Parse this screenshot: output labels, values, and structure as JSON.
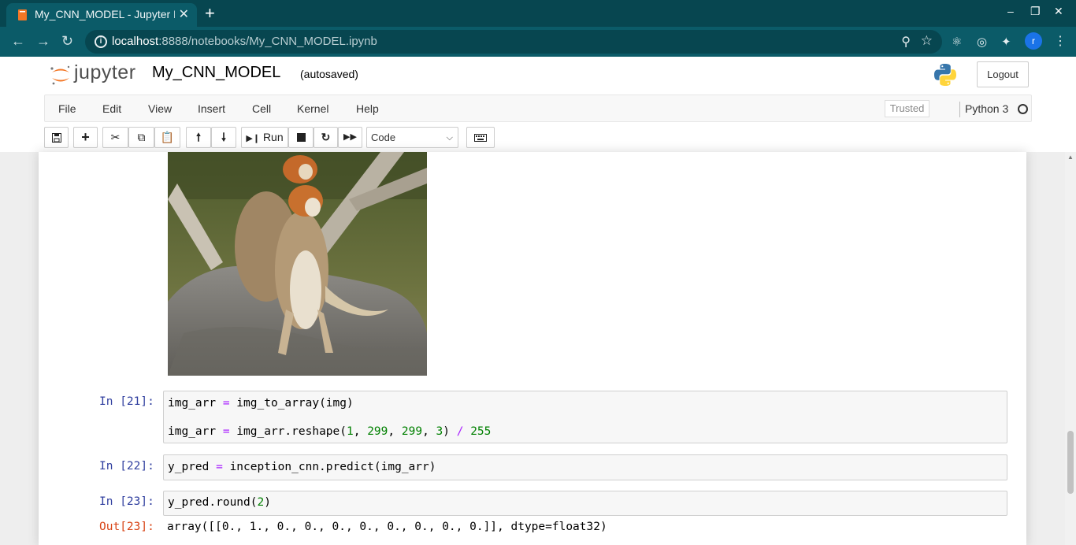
{
  "browser": {
    "tab_title": "My_CNN_MODEL - Jupyter Notebook",
    "tab_close": "✕",
    "new_tab": "+",
    "url_host": "localhost",
    "url_path": ":8888/notebooks/My_CNN_MODEL.ipynb",
    "profile_initial": "r",
    "window_controls": [
      "–",
      "❐",
      "✕"
    ]
  },
  "jupyter": {
    "logo_text": "jupyter",
    "notebook_name": "My_CNN_MODEL",
    "autosave_status": "(autosaved)",
    "logout_label": "Logout",
    "menu": [
      "File",
      "Edit",
      "View",
      "Insert",
      "Cell",
      "Kernel",
      "Help"
    ],
    "trusted_label": "Trusted",
    "kernel_name": "Python 3",
    "run_label": "Run",
    "cell_type": "Code"
  },
  "cells": [
    {
      "prompt": "In [21]:",
      "lines": [
        [
          {
            "t": "img_arr ",
            "c": ""
          },
          {
            "t": "=",
            "c": "op"
          },
          {
            "t": " img_to_array(img)",
            "c": ""
          }
        ],
        [
          {
            "t": "img_arr ",
            "c": ""
          },
          {
            "t": "=",
            "c": "op"
          },
          {
            "t": " img_arr.reshape(",
            "c": ""
          },
          {
            "t": "1",
            "c": "num"
          },
          {
            "t": ", ",
            "c": ""
          },
          {
            "t": "299",
            "c": "num"
          },
          {
            "t": ", ",
            "c": ""
          },
          {
            "t": "299",
            "c": "num"
          },
          {
            "t": ", ",
            "c": ""
          },
          {
            "t": "3",
            "c": "num"
          },
          {
            "t": ") ",
            "c": ""
          },
          {
            "t": "/",
            "c": "op"
          },
          {
            "t": " ",
            "c": ""
          },
          {
            "t": "255",
            "c": "num"
          }
        ]
      ]
    },
    {
      "prompt": "In [22]:",
      "lines": [
        [
          {
            "t": "y_pred ",
            "c": ""
          },
          {
            "t": "=",
            "c": "op"
          },
          {
            "t": " inception_cnn.predict(img_arr)",
            "c": ""
          }
        ]
      ]
    },
    {
      "prompt": "In [23]:",
      "lines": [
        [
          {
            "t": "y_pred.round(",
            "c": ""
          },
          {
            "t": "2",
            "c": "num"
          },
          {
            "t": ")",
            "c": ""
          }
        ]
      ],
      "out_prompt": "Out[23]:",
      "output": "array([[0., 1., 0., 0., 0., 0., 0., 0., 0., 0.]], dtype=float32)"
    }
  ]
}
